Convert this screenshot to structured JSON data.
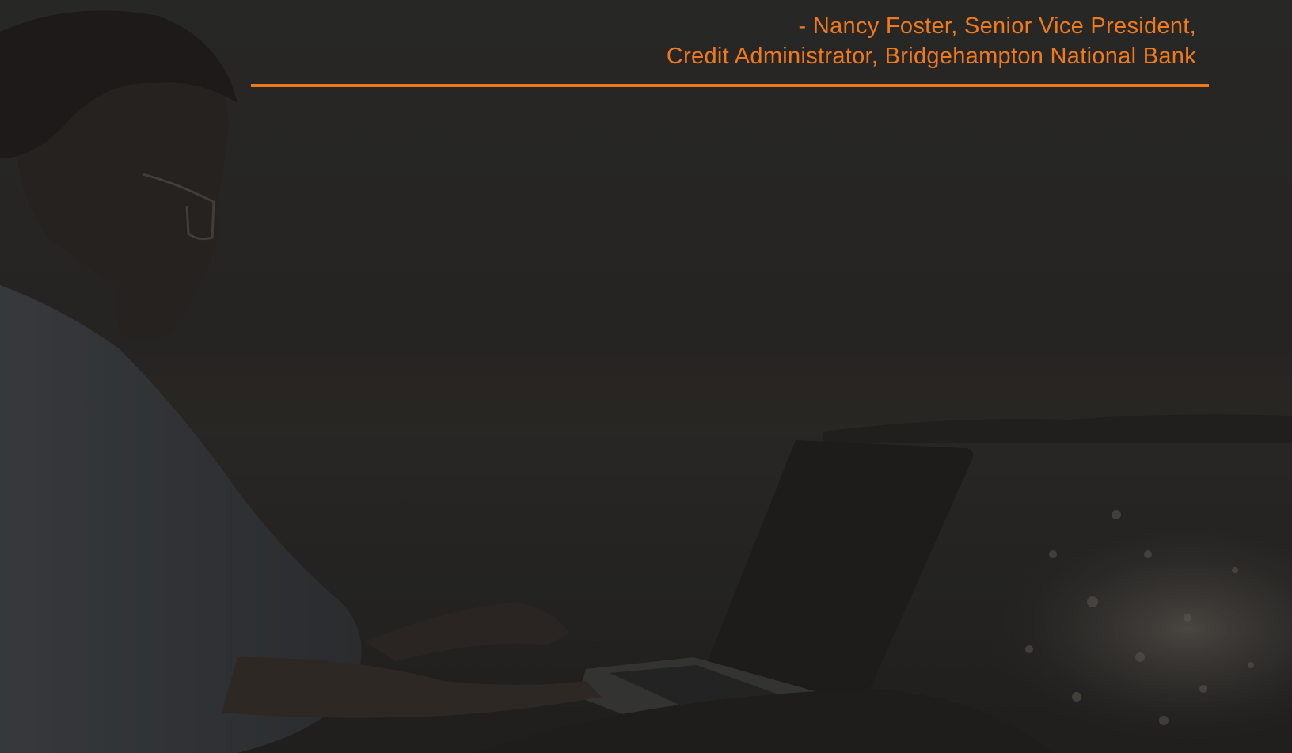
{
  "testimonial": {
    "attribution_line1": "- Nancy Foster, Senior Vice President,",
    "attribution_line2": "Credit Administrator, Bridgehampton National Bank"
  },
  "colors": {
    "accent": "#ee7a1d",
    "overlay": "#2a2a29"
  },
  "background": {
    "image_icon": "man-with-laptop-by-sea-photo"
  }
}
